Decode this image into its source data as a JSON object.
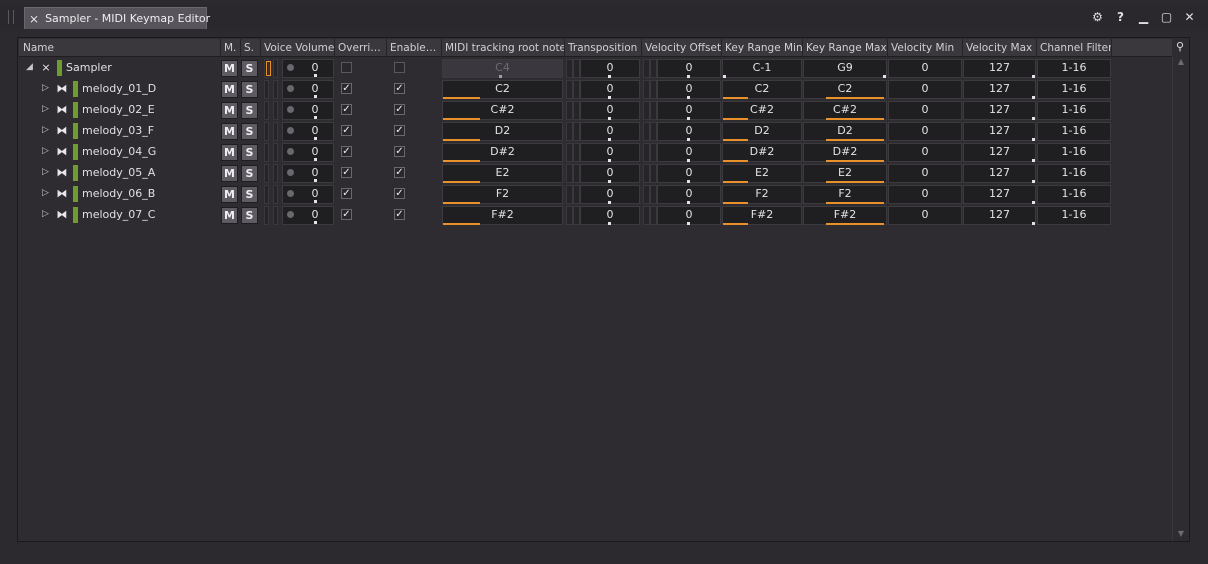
{
  "window": {
    "title": "Sampler - MIDI Keymap Editor",
    "background_tab_hint": "Keymap Editor"
  },
  "header": {
    "columns": [
      {
        "key": "name",
        "label": "Name"
      },
      {
        "key": "mute",
        "label": "M."
      },
      {
        "key": "solo",
        "label": "S."
      },
      {
        "key": "voice_volume",
        "label": "Voice Volume"
      },
      {
        "key": "override",
        "label": "Overri…"
      },
      {
        "key": "enable",
        "label": "Enable…"
      },
      {
        "key": "root_note",
        "label": "MIDI tracking root note"
      },
      {
        "key": "transposition",
        "label": "Transposition"
      },
      {
        "key": "velocity_offset",
        "label": "Velocity Offset"
      },
      {
        "key": "key_min",
        "label": "Key Range Min"
      },
      {
        "key": "key_max",
        "label": "Key Range Max"
      },
      {
        "key": "vel_min",
        "label": "Velocity Min"
      },
      {
        "key": "vel_max",
        "label": "Velocity Max"
      },
      {
        "key": "channel",
        "label": "Channel Filter"
      }
    ]
  },
  "buttons": {
    "mute": "M",
    "solo": "S"
  },
  "rows": [
    {
      "name": "Sampler",
      "expanded": true,
      "level": 0,
      "volume": "0",
      "override": false,
      "enable": false,
      "root_note": "C4",
      "root_dim": true,
      "transposition": "0",
      "velocity_offset": "0",
      "key_min": "C-1",
      "key_max": "G9",
      "vel_min": "0",
      "vel_max": "127",
      "channel": "1-16"
    },
    {
      "name": "melody_01_D",
      "expanded": false,
      "level": 1,
      "volume": "0",
      "override": true,
      "enable": true,
      "root_note": "C2",
      "root_dim": false,
      "transposition": "0",
      "velocity_offset": "0",
      "key_min": "C2",
      "key_max": "C2",
      "vel_min": "0",
      "vel_max": "127",
      "channel": "1-16"
    },
    {
      "name": "melody_02_E",
      "expanded": false,
      "level": 1,
      "volume": "0",
      "override": true,
      "enable": true,
      "root_note": "C#2",
      "root_dim": false,
      "transposition": "0",
      "velocity_offset": "0",
      "key_min": "C#2",
      "key_max": "C#2",
      "vel_min": "0",
      "vel_max": "127",
      "channel": "1-16"
    },
    {
      "name": "melody_03_F",
      "expanded": false,
      "level": 1,
      "volume": "0",
      "override": true,
      "enable": true,
      "root_note": "D2",
      "root_dim": false,
      "transposition": "0",
      "velocity_offset": "0",
      "key_min": "D2",
      "key_max": "D2",
      "vel_min": "0",
      "vel_max": "127",
      "channel": "1-16"
    },
    {
      "name": "melody_04_G",
      "expanded": false,
      "level": 1,
      "volume": "0",
      "override": true,
      "enable": true,
      "root_note": "D#2",
      "root_dim": false,
      "transposition": "0",
      "velocity_offset": "0",
      "key_min": "D#2",
      "key_max": "D#2",
      "vel_min": "0",
      "vel_max": "127",
      "channel": "1-16"
    },
    {
      "name": "melody_05_A",
      "expanded": false,
      "level": 1,
      "volume": "0",
      "override": true,
      "enable": true,
      "root_note": "E2",
      "root_dim": false,
      "transposition": "0",
      "velocity_offset": "0",
      "key_min": "E2",
      "key_max": "E2",
      "vel_min": "0",
      "vel_max": "127",
      "channel": "1-16"
    },
    {
      "name": "melody_06_B",
      "expanded": false,
      "level": 1,
      "volume": "0",
      "override": true,
      "enable": true,
      "root_note": "F2",
      "root_dim": false,
      "transposition": "0",
      "velocity_offset": "0",
      "key_min": "F2",
      "key_max": "F2",
      "vel_min": "0",
      "vel_max": "127",
      "channel": "1-16"
    },
    {
      "name": "melody_07_C",
      "expanded": false,
      "level": 1,
      "volume": "0",
      "override": true,
      "enable": true,
      "root_note": "F#2",
      "root_dim": false,
      "transposition": "0",
      "velocity_offset": "0",
      "key_min": "F#2",
      "key_max": "F#2",
      "vel_min": "0",
      "vel_max": "127",
      "channel": "1-16"
    }
  ],
  "colors": {
    "accent": "#e8902a",
    "track_color": "#6f9c2e"
  },
  "icons": {
    "sampler": "sampler-icon",
    "sample": "sample-icon",
    "settings": "gear-icon",
    "help": "help-icon",
    "minimize": "minimize-icon",
    "maximize": "maximize-icon",
    "close": "close-icon",
    "search": "search-icon"
  }
}
